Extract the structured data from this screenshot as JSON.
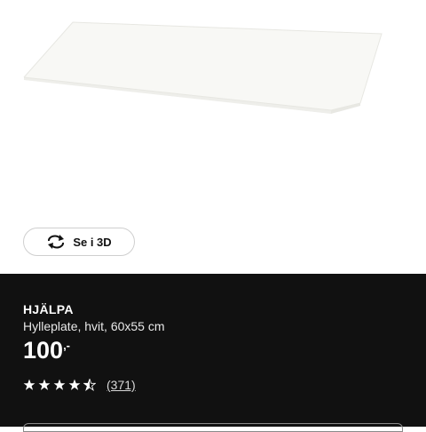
{
  "product": {
    "image_alt": "HJÄLPA shelf",
    "view3d_label": "Se i 3D",
    "name": "HJÄLPA",
    "description": "Hylleplate, hvit, 60x55 cm",
    "price": "100",
    "price_suffix": ",-",
    "rating": {
      "value": 4.5,
      "max": 5,
      "review_count": "(371)"
    }
  },
  "icons": {
    "view3d": "rotate-3d-icon",
    "star": "star-icon"
  },
  "colors": {
    "panel_bg": "#111111",
    "text": "#ffffff",
    "shelf": "#f7f7f4"
  }
}
